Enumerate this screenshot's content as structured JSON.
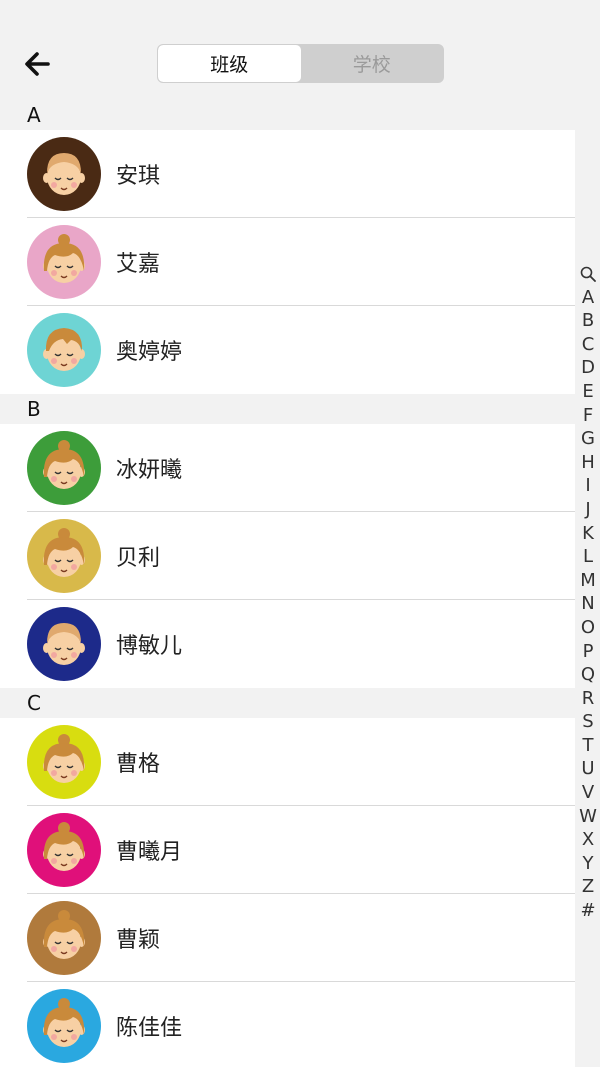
{
  "header": {
    "back_icon": "arrow-left-icon",
    "tabs": [
      {
        "label": "班级",
        "active": true
      },
      {
        "label": "学校",
        "active": false
      }
    ]
  },
  "sections": [
    {
      "letter": "A",
      "contacts": [
        {
          "name": "安琪",
          "avatar_bg": "#4a2a14",
          "hair": "light-brown",
          "style": "boy"
        },
        {
          "name": "艾嘉",
          "avatar_bg": "#e9a6c8",
          "hair": "brown",
          "style": "girl"
        },
        {
          "name": "奥婷婷",
          "avatar_bg": "#6ed4d4",
          "hair": "brown",
          "style": "kid"
        }
      ]
    },
    {
      "letter": "B",
      "contacts": [
        {
          "name": "冰妍曦",
          "avatar_bg": "#3d9d3a",
          "hair": "brown",
          "style": "girl"
        },
        {
          "name": "贝利",
          "avatar_bg": "#d8b94a",
          "hair": "brown",
          "style": "girl"
        },
        {
          "name": "博敏儿",
          "avatar_bg": "#1d2a8a",
          "hair": "light-brown",
          "style": "boy"
        }
      ]
    },
    {
      "letter": "C",
      "contacts": [
        {
          "name": "曹格",
          "avatar_bg": "#d8dd10",
          "hair": "brown",
          "style": "girl"
        },
        {
          "name": "曹曦月",
          "avatar_bg": "#e0107a",
          "hair": "brown",
          "style": "girl"
        },
        {
          "name": "曹颖",
          "avatar_bg": "#b07a3c",
          "hair": "brown",
          "style": "girl"
        },
        {
          "name": "陈佳佳",
          "avatar_bg": "#2aa8e0",
          "hair": "brown",
          "style": "girl"
        }
      ]
    }
  ],
  "index_bar": {
    "search_icon": "search-icon",
    "letters": [
      "A",
      "B",
      "C",
      "D",
      "E",
      "F",
      "G",
      "H",
      "I",
      "J",
      "K",
      "L",
      "M",
      "N",
      "O",
      "P",
      "Q",
      "R",
      "S",
      "T",
      "U",
      "V",
      "W",
      "X",
      "Y",
      "Z",
      "#"
    ]
  },
  "colors": {
    "background": "#f2f2f2",
    "row_bg": "#ffffff",
    "divider": "#d9d9d9",
    "segment_inactive": "#cfcfcf"
  }
}
